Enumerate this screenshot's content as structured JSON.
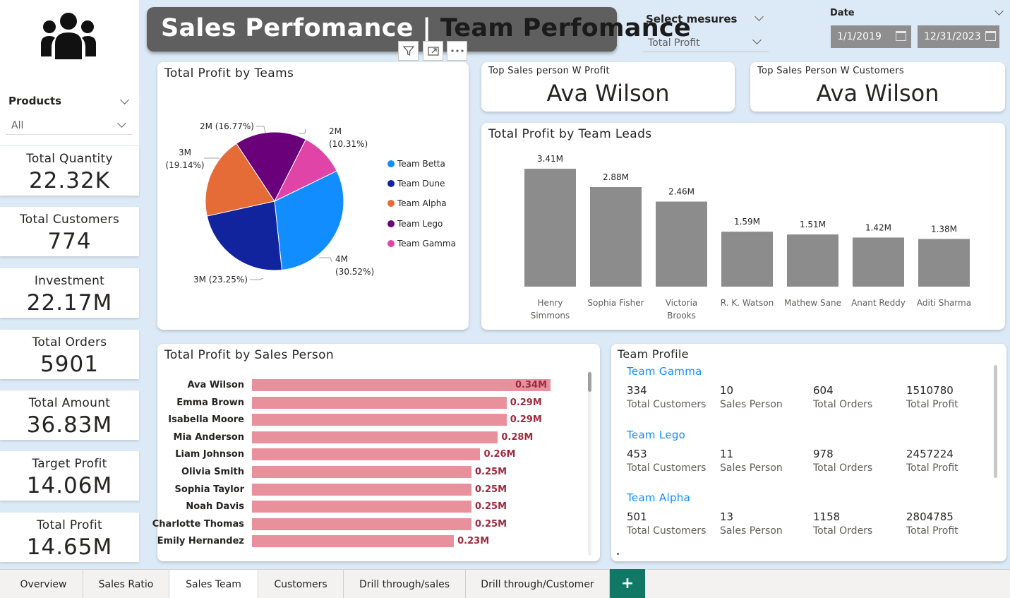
{
  "header": {
    "title_part1": "Sales Perfomance |",
    "title_part2": "Team Perfomance"
  },
  "sidebar": {
    "products_label": "Products",
    "products_value": "All",
    "kpis": [
      {
        "label": "Total Quantity",
        "value": "22.32K"
      },
      {
        "label": "Total Customers",
        "value": "774"
      },
      {
        "label": "Investment",
        "value": "22.17M"
      },
      {
        "label": "Total Orders",
        "value": "5901"
      },
      {
        "label": "Total Amount",
        "value": "36.83M"
      },
      {
        "label": "Target Profit",
        "value": "14.06M"
      },
      {
        "label": "Total Profit",
        "value": "14.65M"
      }
    ]
  },
  "filters": {
    "measures_label": "Select mesures",
    "measures_value": "Total Profit",
    "date_label": "Date",
    "date_start": "1/1/2019",
    "date_end": "12/31/2023"
  },
  "cards": {
    "top_profit_label": "Top Sales person W Profit",
    "top_profit_value": "Ava Wilson",
    "top_customers_label": "Top Sales Person W Customers",
    "top_customers_value": "Ava Wilson"
  },
  "colors": {
    "team_betta": "#118dff",
    "team_dune": "#12239e",
    "team_alpha": "#e66c37",
    "team_lego": "#6b007b",
    "team_gamma": "#e044a7",
    "bar_gray": "#8c8c8c",
    "bar_pink": "#e8919c"
  },
  "pie": {
    "title": "Total Profit by Teams",
    "legend": [
      "Team Betta",
      "Team Dune",
      "Team Alpha",
      "Team Lego",
      "Team Gamma"
    ],
    "slice_labels": {
      "betta_a": "4M",
      "betta_b": "(30.52%)",
      "dune": "3M (23.25%)",
      "alpha_a": "3M",
      "alpha_b": "(19.14%)",
      "lego": "2M (16.77%)",
      "gamma_a": "2M",
      "gamma_b": "(10.31%)"
    }
  },
  "leads": {
    "title": "Total Profit by Team Leads",
    "names_line1": [
      "Henry",
      "Sophia Fisher",
      "Victoria",
      "R. K. Watson",
      "Mathew Sane",
      "Anant Reddy",
      "Aditi Sharma"
    ],
    "names_line2": [
      "Simmons",
      "",
      "Brooks",
      "",
      "",
      "",
      ""
    ],
    "labels": [
      "3.41M",
      "2.88M",
      "2.46M",
      "1.59M",
      "1.51M",
      "1.42M",
      "1.38M"
    ]
  },
  "salesperson": {
    "title": "Total Profit by Sales Person",
    "names": [
      "Ava Wilson",
      "Emma Brown",
      "Isabella Moore",
      "Mia Anderson",
      "Liam Johnson",
      "Olivia Smith",
      "Sophia Taylor",
      "Noah Davis",
      "Charlotte Thomas",
      "Emily Hernandez"
    ],
    "labels": [
      "0.34M",
      "0.29M",
      "0.29M",
      "0.28M",
      "0.26M",
      "0.25M",
      "0.25M",
      "0.25M",
      "0.25M",
      "0.23M"
    ]
  },
  "team_profile": {
    "title": "Team Profile",
    "metric_labels": [
      "Total Customers",
      "Sales Person",
      "Total Orders",
      "Total Profit"
    ],
    "teams": [
      {
        "name": "Team Gamma",
        "values": [
          "334",
          "10",
          "604",
          "1510780"
        ]
      },
      {
        "name": "Team Lego",
        "values": [
          "453",
          "11",
          "978",
          "2457224"
        ]
      },
      {
        "name": "Team Alpha",
        "values": [
          "501",
          "13",
          "1158",
          "2804785"
        ]
      }
    ]
  },
  "tabs": [
    "Overview",
    "Sales Ratio",
    "Sales Team",
    "Customers",
    "Drill through/sales",
    "Drill through/Customer"
  ],
  "add_tab_label": "+",
  "chart_data": [
    {
      "type": "pie",
      "title": "Total Profit by Teams",
      "categories": [
        "Team Betta",
        "Team Dune",
        "Team Alpha",
        "Team Lego",
        "Team Gamma"
      ],
      "values": [
        30.52,
        23.25,
        19.14,
        16.77,
        10.31
      ],
      "legend": "right"
    },
    {
      "type": "bar",
      "title": "Total Profit by Team Leads",
      "categories": [
        "Henry Simmons",
        "Sophia Fisher",
        "Victoria Brooks",
        "R. K. Watson",
        "Mathew Sane",
        "Anant Reddy",
        "Aditi Sharma"
      ],
      "values": [
        3.41,
        2.88,
        2.46,
        1.59,
        1.51,
        1.42,
        1.38
      ],
      "ylim": [
        0,
        3.41
      ]
    },
    {
      "type": "bar",
      "orientation": "horizontal",
      "title": "Total Profit by Sales Person",
      "categories": [
        "Ava Wilson",
        "Emma Brown",
        "Isabella Moore",
        "Mia Anderson",
        "Liam Johnson",
        "Olivia Smith",
        "Sophia Taylor",
        "Noah Davis",
        "Charlotte Thomas",
        "Emily Hernandez"
      ],
      "values": [
        0.34,
        0.29,
        0.29,
        0.28,
        0.26,
        0.25,
        0.25,
        0.25,
        0.25,
        0.23
      ]
    }
  ]
}
